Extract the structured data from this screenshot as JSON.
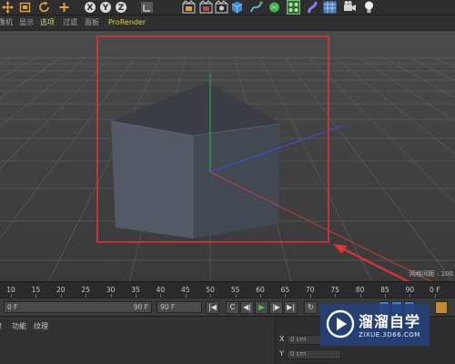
{
  "app": {
    "name": "Cinema 4D viewport"
  },
  "toolbar": {
    "icons": [
      {
        "name": "move-icon",
        "color": "#e4a23a"
      },
      {
        "name": "scale-icon",
        "color": "#e4a23a"
      },
      {
        "name": "rotate-icon",
        "color": "#e4a23a"
      },
      {
        "name": "add-icon",
        "color": "#e4a23a"
      },
      {
        "name": "x-axis-lock-icon",
        "label": "X"
      },
      {
        "name": "y-axis-lock-icon",
        "label": "Y"
      },
      {
        "name": "z-axis-lock-icon",
        "label": "Z"
      },
      {
        "name": "coordinate-system-icon"
      },
      {
        "name": "render-view-icon"
      },
      {
        "name": "render-picture-viewer-icon"
      },
      {
        "name": "render-settings-icon"
      },
      {
        "name": "cube-object-icon"
      },
      {
        "name": "spline-pen-icon"
      },
      {
        "name": "subdivision-icon"
      },
      {
        "name": "array-icon"
      },
      {
        "name": "deformer-icon"
      },
      {
        "name": "floor-icon"
      },
      {
        "name": "camera-icon"
      },
      {
        "name": "light-icon"
      }
    ]
  },
  "view_menu": {
    "items": [
      {
        "label": "摄像机"
      },
      {
        "label": "显示"
      },
      {
        "label": "选项",
        "active": true
      },
      {
        "label": "过滤"
      },
      {
        "label": "面板"
      },
      {
        "label": "ProRender",
        "active": true
      }
    ]
  },
  "viewport": {
    "grid_spacing_label": "网格间距 : 100",
    "background_color": "#404040",
    "selection_box_color": "#e03434",
    "axis_colors": {
      "x": "#c33c3c",
      "y": "#2fb34a",
      "z": "#3b4ee0"
    }
  },
  "timeline": {
    "ticks": [
      "10",
      "15",
      "20",
      "25",
      "30",
      "35",
      "40",
      "45",
      "50",
      "55",
      "60",
      "65",
      "70",
      "75",
      "80",
      "85",
      "90",
      "0 F"
    ]
  },
  "transport": {
    "start_frame": "0 F",
    "end_frame_slider": "90 F",
    "end_frame": "90 F",
    "buttons": [
      "|◀",
      "C",
      "◀|",
      "◀",
      "▶",
      "|▶",
      "▶|",
      "↻"
    ]
  },
  "materials": {
    "tabs": [
      "创建",
      "功能",
      "纹理"
    ]
  },
  "coordinates": {
    "rows": [
      {
        "axis": "X",
        "value": "0 cm"
      },
      {
        "axis": "Y",
        "value": "0 cm"
      }
    ]
  },
  "watermark": {
    "title": "溜溜自学",
    "subtitle": "ZIXUE.3D66.COM"
  }
}
